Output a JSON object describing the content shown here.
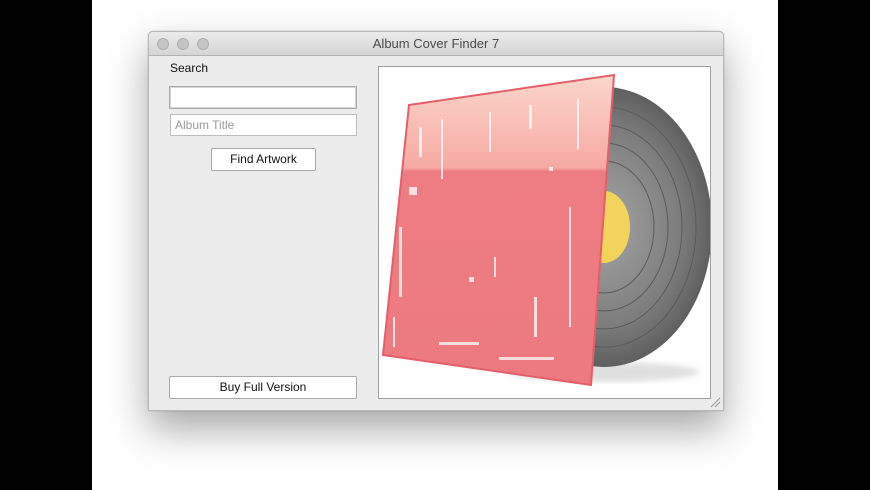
{
  "window": {
    "title": "Album Cover Finder 7"
  },
  "search": {
    "label": "Search",
    "query_value": "",
    "album_placeholder": "Album Title"
  },
  "buttons": {
    "find_label": "Find Artwork",
    "buy_label": "Buy Full Version"
  },
  "colors": {
    "cover_pink": "#ef7f84",
    "cover_highlight": "#fbd1c6",
    "record_label": "#f2d45c",
    "vinyl_gray": "#7b7b7b"
  }
}
